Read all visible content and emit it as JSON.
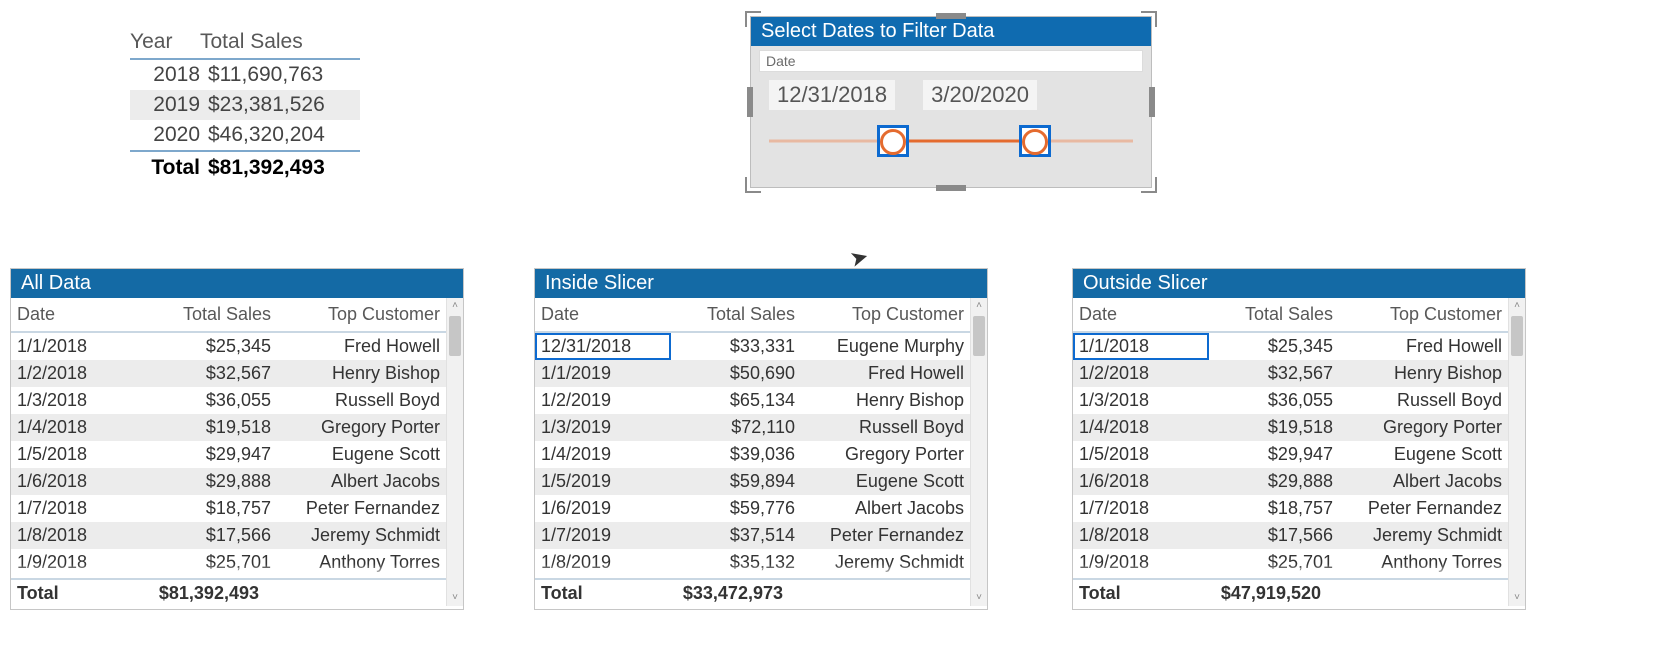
{
  "summary": {
    "headers": {
      "year": "Year",
      "sales": "Total Sales"
    },
    "rows": [
      {
        "year": "2018",
        "sales": "$11,690,763"
      },
      {
        "year": "2019",
        "sales": "$23,381,526"
      },
      {
        "year": "2020",
        "sales": "$46,320,204"
      }
    ],
    "total_label": "Total",
    "total_value": "$81,392,493"
  },
  "slicer": {
    "title": "Select Dates to Filter Data",
    "field": "Date",
    "from": "12/31/2018",
    "to": "3/20/2020"
  },
  "tables": {
    "headers": {
      "date": "Date",
      "sales": "Total Sales",
      "customer": "Top Customer"
    },
    "total_label": "Total",
    "all": {
      "title": "All Data",
      "rows": [
        {
          "date": "1/1/2018",
          "sales": "$25,345",
          "customer": "Fred Howell"
        },
        {
          "date": "1/2/2018",
          "sales": "$32,567",
          "customer": "Henry Bishop"
        },
        {
          "date": "1/3/2018",
          "sales": "$36,055",
          "customer": "Russell Boyd"
        },
        {
          "date": "1/4/2018",
          "sales": "$19,518",
          "customer": "Gregory Porter"
        },
        {
          "date": "1/5/2018",
          "sales": "$29,947",
          "customer": "Eugene Scott"
        },
        {
          "date": "1/6/2018",
          "sales": "$29,888",
          "customer": "Albert Jacobs"
        },
        {
          "date": "1/7/2018",
          "sales": "$18,757",
          "customer": "Peter Fernandez"
        },
        {
          "date": "1/8/2018",
          "sales": "$17,566",
          "customer": "Jeremy Schmidt"
        },
        {
          "date": "1/9/2018",
          "sales": "$25,701",
          "customer": "Anthony Torres"
        }
      ],
      "highlight_row": null,
      "total": "$81,392,493"
    },
    "inside": {
      "title": "Inside Slicer",
      "rows": [
        {
          "date": "12/31/2018",
          "sales": "$33,331",
          "customer": "Eugene Murphy"
        },
        {
          "date": "1/1/2019",
          "sales": "$50,690",
          "customer": "Fred Howell"
        },
        {
          "date": "1/2/2019",
          "sales": "$65,134",
          "customer": "Henry Bishop"
        },
        {
          "date": "1/3/2019",
          "sales": "$72,110",
          "customer": "Russell Boyd"
        },
        {
          "date": "1/4/2019",
          "sales": "$39,036",
          "customer": "Gregory Porter"
        },
        {
          "date": "1/5/2019",
          "sales": "$59,894",
          "customer": "Eugene Scott"
        },
        {
          "date": "1/6/2019",
          "sales": "$59,776",
          "customer": "Albert Jacobs"
        },
        {
          "date": "1/7/2019",
          "sales": "$37,514",
          "customer": "Peter Fernandez"
        },
        {
          "date": "1/8/2019",
          "sales": "$35,132",
          "customer": "Jeremy Schmidt"
        }
      ],
      "highlight_row": 0,
      "total": "$33,472,973"
    },
    "outside": {
      "title": "Outside Slicer",
      "rows": [
        {
          "date": "1/1/2018",
          "sales": "$25,345",
          "customer": "Fred Howell"
        },
        {
          "date": "1/2/2018",
          "sales": "$32,567",
          "customer": "Henry Bishop"
        },
        {
          "date": "1/3/2018",
          "sales": "$36,055",
          "customer": "Russell Boyd"
        },
        {
          "date": "1/4/2018",
          "sales": "$19,518",
          "customer": "Gregory Porter"
        },
        {
          "date": "1/5/2018",
          "sales": "$29,947",
          "customer": "Eugene Scott"
        },
        {
          "date": "1/6/2018",
          "sales": "$29,888",
          "customer": "Albert Jacobs"
        },
        {
          "date": "1/7/2018",
          "sales": "$18,757",
          "customer": "Peter Fernandez"
        },
        {
          "date": "1/8/2018",
          "sales": "$17,566",
          "customer": "Jeremy Schmidt"
        },
        {
          "date": "1/9/2018",
          "sales": "$25,701",
          "customer": "Anthony Torres"
        }
      ],
      "highlight_row": 0,
      "total": "$47,919,520"
    }
  }
}
